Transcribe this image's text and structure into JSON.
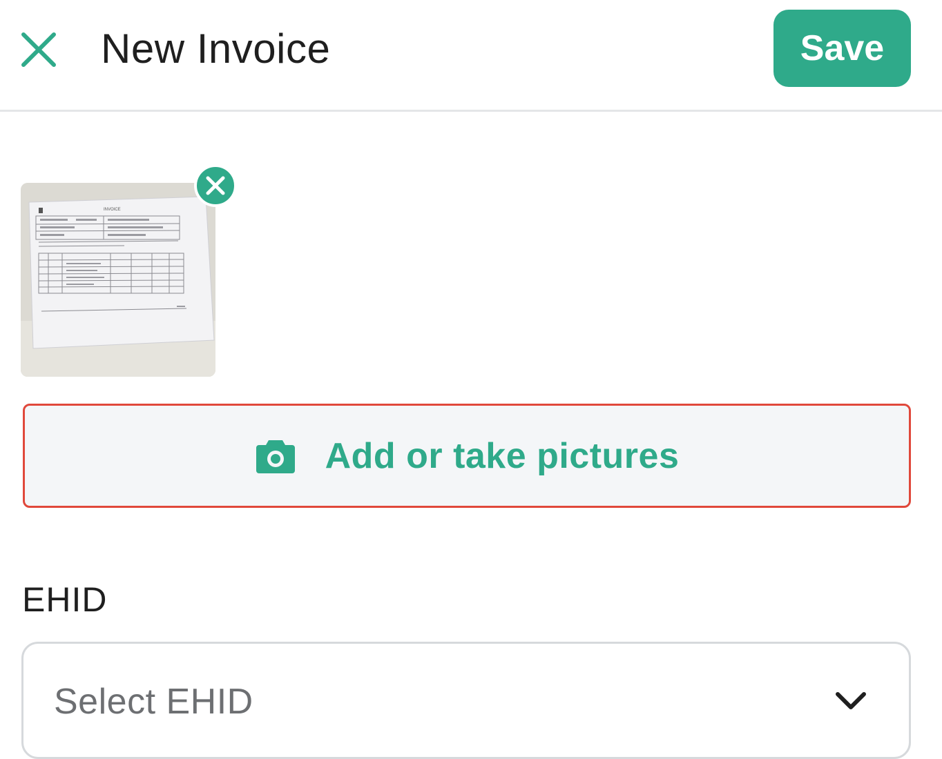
{
  "header": {
    "title": "New Invoice",
    "save_label": "Save",
    "close_icon": "close-icon"
  },
  "attachment": {
    "thumbnail_heading": "INVOICE",
    "remove_icon": "remove-circle-icon"
  },
  "add_pictures": {
    "label": "Add or take pictures",
    "icon": "camera-icon"
  },
  "ehid": {
    "label": "EHID",
    "placeholder": "Select EHID",
    "icon": "chevron-down-icon"
  },
  "colors": {
    "accent": "#2faa8a",
    "highlight_border": "#e0483b",
    "button_bg": "#f4f6f8"
  }
}
